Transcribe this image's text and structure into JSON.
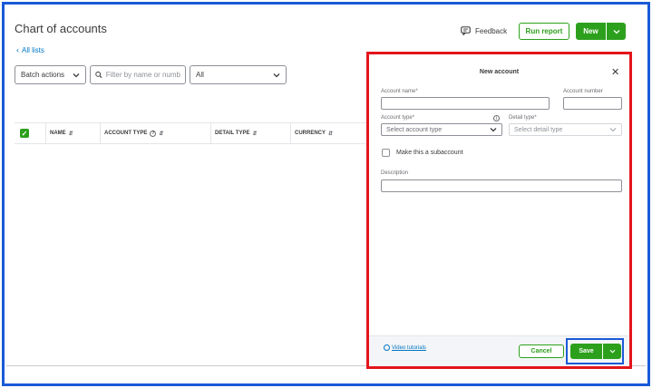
{
  "header": {
    "title": "Chart of accounts",
    "back_link": "All lists",
    "feedback_label": "Feedback",
    "run_report_label": "Run report",
    "new_label": "New"
  },
  "toolbar": {
    "batch_actions_label": "Batch actions",
    "filter_placeholder": "Filter by name or number",
    "filter_text": "Filter by name or numb",
    "type_filter_value": "All"
  },
  "table": {
    "columns": [
      "NAME",
      "ACCOUNT TYPE",
      "DETAIL TYPE",
      "CURRENCY"
    ]
  },
  "panel": {
    "title": "New account",
    "account_name_label": "Account name*",
    "account_number_label": "Account number",
    "account_type_label": "Account type*",
    "account_type_placeholder": "Select account type",
    "detail_type_label": "Detail type*",
    "detail_type_placeholder": "Select detail type",
    "subaccount_label": "Make this a subaccount",
    "description_label": "Description",
    "video_tutorials_label": "Video tutorials",
    "cancel_label": "Cancel",
    "save_label": "Save"
  },
  "colors": {
    "brand_green": "#2ca01c",
    "link_blue": "#0077c5",
    "highlight_red": "#e4141b",
    "highlight_blue": "#1a5ad7"
  },
  "icons": [
    "chevron-left-icon",
    "feedback-icon",
    "chevron-down-icon",
    "search-icon",
    "checkbox-checked-icon",
    "sort-icon",
    "info-icon",
    "close-icon",
    "play-icon"
  ]
}
